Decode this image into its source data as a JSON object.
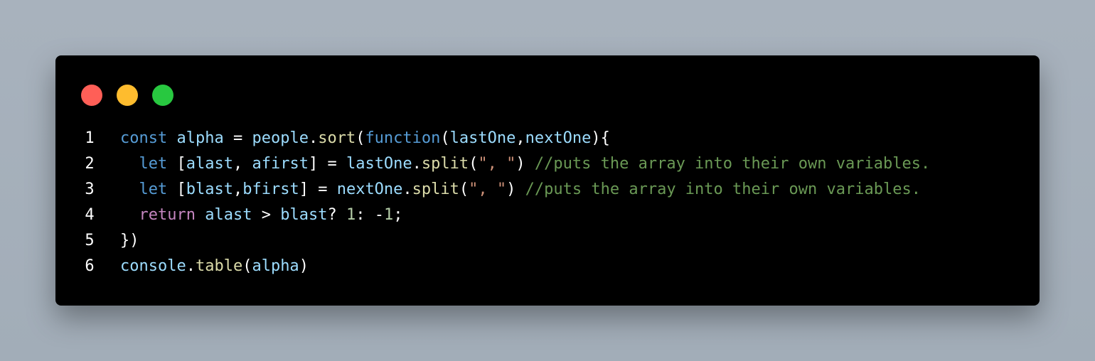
{
  "window": {
    "controls": {
      "close_color": "#ff5f57",
      "minimize_color": "#febc2e",
      "maximize_color": "#28c840"
    }
  },
  "code": {
    "lines": [
      {
        "number": "1",
        "tokens": [
          {
            "text": "const",
            "kind": "kw"
          },
          {
            "text": " ",
            "kind": "plain"
          },
          {
            "text": "alpha",
            "kind": "var"
          },
          {
            "text": " = ",
            "kind": "plain"
          },
          {
            "text": "people",
            "kind": "var"
          },
          {
            "text": ".",
            "kind": "plain"
          },
          {
            "text": "sort",
            "kind": "fn"
          },
          {
            "text": "(",
            "kind": "plain"
          },
          {
            "text": "function",
            "kind": "kw"
          },
          {
            "text": "(",
            "kind": "plain"
          },
          {
            "text": "lastOne",
            "kind": "var"
          },
          {
            "text": ",",
            "kind": "plain"
          },
          {
            "text": "nextOne",
            "kind": "var"
          },
          {
            "text": "){",
            "kind": "plain"
          }
        ]
      },
      {
        "number": "2",
        "tokens": [
          {
            "text": "  ",
            "kind": "plain"
          },
          {
            "text": "let",
            "kind": "kw"
          },
          {
            "text": " [",
            "kind": "plain"
          },
          {
            "text": "alast",
            "kind": "var"
          },
          {
            "text": ", ",
            "kind": "plain"
          },
          {
            "text": "afirst",
            "kind": "var"
          },
          {
            "text": "] = ",
            "kind": "plain"
          },
          {
            "text": "lastOne",
            "kind": "var"
          },
          {
            "text": ".",
            "kind": "plain"
          },
          {
            "text": "split",
            "kind": "fn"
          },
          {
            "text": "(",
            "kind": "plain"
          },
          {
            "text": "\", \"",
            "kind": "str"
          },
          {
            "text": ") ",
            "kind": "plain"
          },
          {
            "text": "//puts the array into their own variables.",
            "kind": "cmt"
          }
        ]
      },
      {
        "number": "3",
        "tokens": [
          {
            "text": "  ",
            "kind": "plain"
          },
          {
            "text": "let",
            "kind": "kw"
          },
          {
            "text": " [",
            "kind": "plain"
          },
          {
            "text": "blast",
            "kind": "var"
          },
          {
            "text": ",",
            "kind": "plain"
          },
          {
            "text": "bfirst",
            "kind": "var"
          },
          {
            "text": "] = ",
            "kind": "plain"
          },
          {
            "text": "nextOne",
            "kind": "var"
          },
          {
            "text": ".",
            "kind": "plain"
          },
          {
            "text": "split",
            "kind": "fn"
          },
          {
            "text": "(",
            "kind": "plain"
          },
          {
            "text": "\", \"",
            "kind": "str"
          },
          {
            "text": ") ",
            "kind": "plain"
          },
          {
            "text": "//puts the array into their own variables.",
            "kind": "cmt"
          }
        ]
      },
      {
        "number": "4",
        "tokens": [
          {
            "text": "  ",
            "kind": "plain"
          },
          {
            "text": "return",
            "kind": "ctrl"
          },
          {
            "text": " ",
            "kind": "plain"
          },
          {
            "text": "alast",
            "kind": "var"
          },
          {
            "text": " > ",
            "kind": "plain"
          },
          {
            "text": "blast",
            "kind": "var"
          },
          {
            "text": "? ",
            "kind": "plain"
          },
          {
            "text": "1",
            "kind": "num"
          },
          {
            "text": ": -",
            "kind": "plain"
          },
          {
            "text": "1",
            "kind": "num"
          },
          {
            "text": ";",
            "kind": "plain"
          }
        ]
      },
      {
        "number": "5",
        "tokens": [
          {
            "text": "})",
            "kind": "plain"
          }
        ]
      },
      {
        "number": "6",
        "tokens": [
          {
            "text": "console",
            "kind": "var"
          },
          {
            "text": ".",
            "kind": "plain"
          },
          {
            "text": "table",
            "kind": "fn"
          },
          {
            "text": "(",
            "kind": "plain"
          },
          {
            "text": "alpha",
            "kind": "var"
          },
          {
            "text": ")",
            "kind": "plain"
          }
        ]
      }
    ]
  }
}
